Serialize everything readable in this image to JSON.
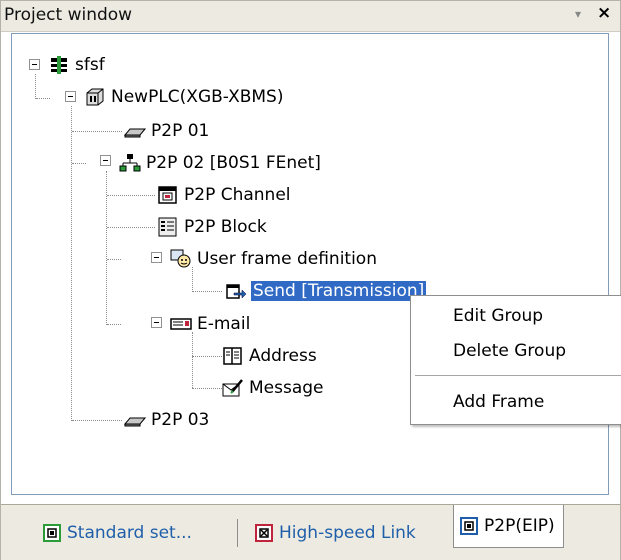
{
  "window": {
    "title": "Project window",
    "pin_glyph": "▾",
    "close_glyph": "×"
  },
  "tree": {
    "root": {
      "label": "sfsf",
      "icon": "project-icon"
    },
    "plc": {
      "label": "NewPLC(XGB-XBMS)",
      "icon": "plc-icon"
    },
    "p2p01": {
      "label": "P2P 01",
      "icon": "p2p-icon"
    },
    "p2p02": {
      "label": "P2P 02 [B0S1 FEnet]",
      "icon": "network-icon"
    },
    "channel": {
      "label": "P2P Channel",
      "icon": "channel-icon"
    },
    "block": {
      "label": "P2P Block",
      "icon": "block-icon"
    },
    "userframe": {
      "label": "User frame definition",
      "icon": "user-frame-icon"
    },
    "send": {
      "label": "Send  [Transmission]",
      "icon": "send-icon"
    },
    "email": {
      "label": "E-mail",
      "icon": "email-icon"
    },
    "address": {
      "label": "Address",
      "icon": "address-book-icon"
    },
    "message": {
      "label": "Message",
      "icon": "message-icon"
    },
    "p2p03": {
      "label": "P2P 03",
      "icon": "p2p-icon"
    }
  },
  "context_menu": {
    "items": [
      "Edit Group",
      "Delete Group",
      "Add Frame"
    ]
  },
  "tabs": [
    {
      "label": "Standard set...",
      "color": "#1f5faa",
      "icon": "standard-settings-icon"
    },
    {
      "label": "High-speed Link",
      "color": "#1f5faa",
      "icon": "high-speed-link-icon"
    },
    {
      "label": "P2P(EIP)",
      "color": "#000000",
      "icon": "p2p-eip-icon",
      "active": true
    }
  ],
  "colors": {
    "selection": "#316ac5",
    "accent_green": "#2a9d3a",
    "accent_red": "#c0243c"
  }
}
